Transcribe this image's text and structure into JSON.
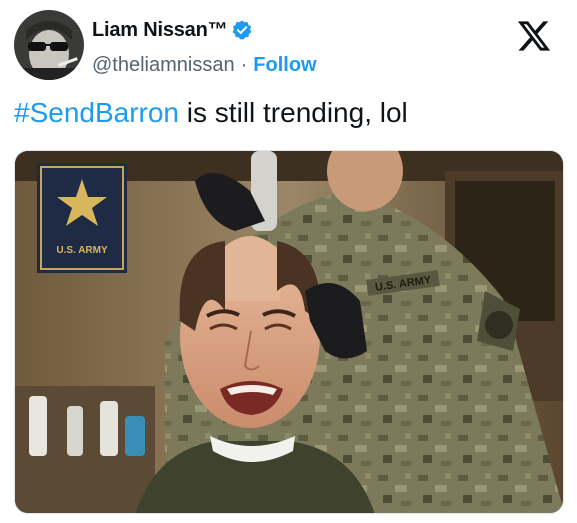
{
  "user": {
    "display_name": "Liam Nissan™",
    "handle": "@theliamnissan",
    "separator": "·",
    "follow_label": "Follow",
    "verified_icon": "verified-badge-icon",
    "accent_color": "#1d9bf0"
  },
  "brand": {
    "logo_icon": "x-logo-icon"
  },
  "tweet": {
    "hashtag": "#SendBarron",
    "text": " is still trending, lol"
  },
  "media": {
    "patch_text": "U.S. ARMY",
    "sign_text": "U.S. ARMY"
  }
}
